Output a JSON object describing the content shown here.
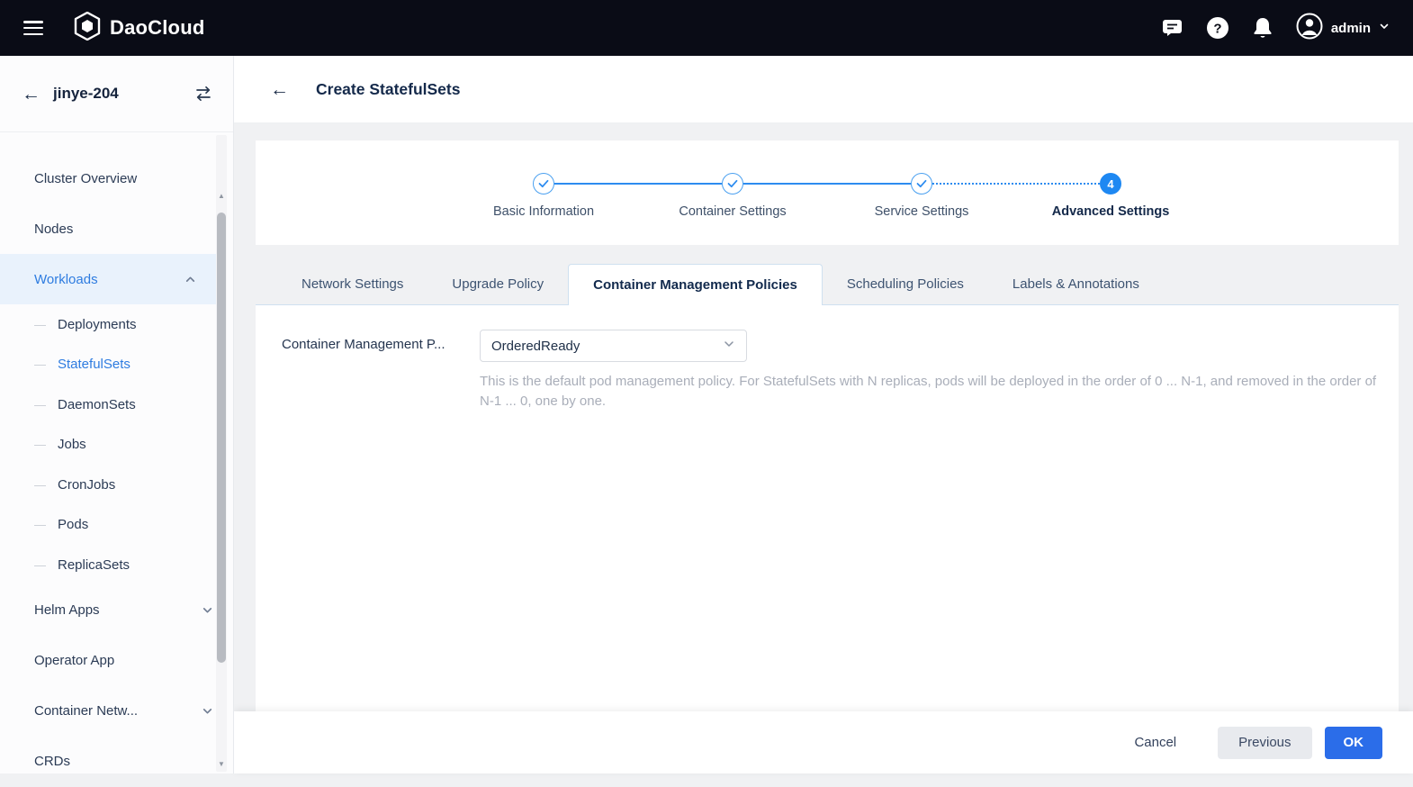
{
  "topbar": {
    "brand": "DaoCloud",
    "user": "admin"
  },
  "sidebar": {
    "cluster": "jinye-204",
    "items": [
      {
        "label": "Cluster Overview"
      },
      {
        "label": "Nodes"
      },
      {
        "label": "Workloads"
      },
      {
        "label": "Deployments"
      },
      {
        "label": "StatefulSets"
      },
      {
        "label": "DaemonSets"
      },
      {
        "label": "Jobs"
      },
      {
        "label": "CronJobs"
      },
      {
        "label": "Pods"
      },
      {
        "label": "ReplicaSets"
      },
      {
        "label": "Helm Apps"
      },
      {
        "label": "Operator App"
      },
      {
        "label": "Container Netw..."
      },
      {
        "label": "CRDs"
      }
    ]
  },
  "page": {
    "title": "Create StatefulSets"
  },
  "stepper": {
    "steps": [
      {
        "label": "Basic Information",
        "state": "done"
      },
      {
        "label": "Container Settings",
        "state": "done"
      },
      {
        "label": "Service Settings",
        "state": "done"
      },
      {
        "label": "Advanced Settings",
        "state": "current",
        "number": "4"
      }
    ]
  },
  "tabs": [
    {
      "label": "Network Settings"
    },
    {
      "label": "Upgrade Policy"
    },
    {
      "label": "Container Management Policies",
      "active": true
    },
    {
      "label": "Scheduling Policies"
    },
    {
      "label": "Labels & Annotations"
    }
  ],
  "form": {
    "policy_label": "Container Management P...",
    "policy_value": "OrderedReady",
    "policy_help": "This is the default pod management policy. For StatefulSets with N replicas, pods will be deployed in the order of 0 ... N-1, and removed in the order of N-1 ... 0, one by one."
  },
  "footer": {
    "cancel": "Cancel",
    "previous": "Previous",
    "ok": "OK"
  },
  "icons": {
    "back_arrow": "←",
    "dash": "—",
    "scroll_up": "▲",
    "scroll_down": "▼"
  },
  "colors": {
    "accent": "#2d8cf0",
    "primary": "#2b6de9",
    "topbar_bg": "#0a0c16",
    "sidebar_active_bg": "#e9f2fc"
  }
}
